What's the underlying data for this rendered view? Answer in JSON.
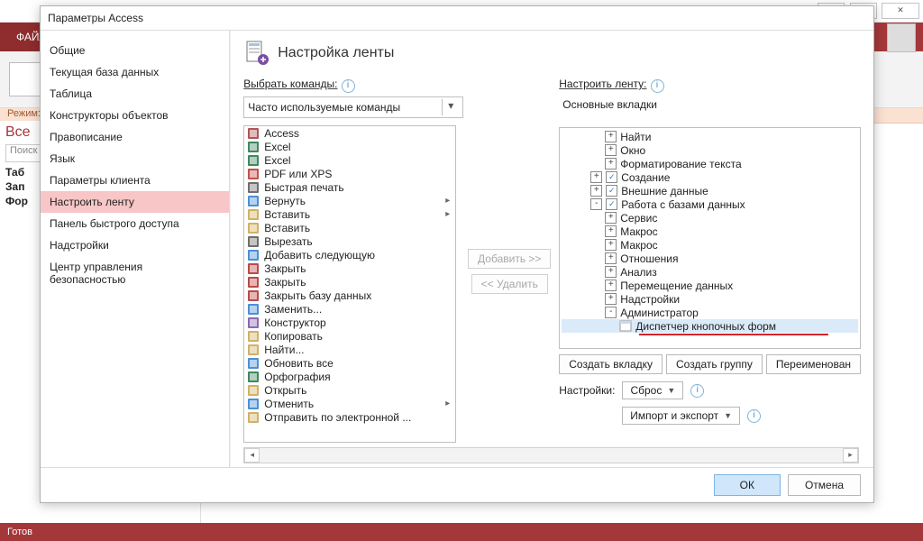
{
  "app": {
    "title_visible": "Параметры Access",
    "tab": "ФАЙЛ",
    "mode": "Режим",
    "mode2_prefix": "Режим:",
    "status": "Готов"
  },
  "bg": {
    "left_hdr": "Все",
    "search": "Поиск",
    "items": [
      "Таб",
      "Зап",
      "Фор"
    ]
  },
  "dialog": {
    "title": "Параметры Access",
    "categories": [
      "Общие",
      "Текущая база данных",
      "Таблица",
      "Конструкторы объектов",
      "Правописание",
      "Язык",
      "Параметры клиента",
      "Настроить ленту",
      "Панель быстрого доступа",
      "Надстройки",
      "Центр управления безопасностью"
    ],
    "selected_cat": 7,
    "page_title": "Настройка ленты",
    "left": {
      "label": "Выбрать команды:",
      "combo": "Часто используемые команды",
      "items": [
        {
          "t": "Access",
          "ic": "acc"
        },
        {
          "t": "Excel",
          "ic": "xls"
        },
        {
          "t": "Excel",
          "ic": "xls"
        },
        {
          "t": "PDF или XPS",
          "ic": "pdf"
        },
        {
          "t": "Быстрая печать",
          "ic": "print"
        },
        {
          "t": "Вернуть",
          "ic": "redo",
          "sub": "▸"
        },
        {
          "t": "Вставить",
          "ic": "paste",
          "sub": "▸"
        },
        {
          "t": "Вставить",
          "ic": "paste"
        },
        {
          "t": "Вырезать",
          "ic": "cut"
        },
        {
          "t": "Добавить следующую",
          "ic": "add"
        },
        {
          "t": "Закрыть",
          "ic": "close"
        },
        {
          "t": "Закрыть",
          "ic": "close"
        },
        {
          "t": "Закрыть базу данных",
          "ic": "closedb"
        },
        {
          "t": "Заменить...",
          "ic": "replace"
        },
        {
          "t": "Конструктор",
          "ic": "design"
        },
        {
          "t": "Копировать",
          "ic": "copy"
        },
        {
          "t": "Найти...",
          "ic": "find"
        },
        {
          "t": "Обновить все",
          "ic": "refresh"
        },
        {
          "t": "Орфография",
          "ic": "spell"
        },
        {
          "t": "Открыть",
          "ic": "open"
        },
        {
          "t": "Отменить",
          "ic": "undo",
          "sub": "▸"
        },
        {
          "t": "Отправить по электронной ...",
          "ic": "mail"
        }
      ]
    },
    "mid": {
      "add": "Добавить >>",
      "remove": "<< Удалить"
    },
    "right": {
      "label": "Настроить ленту:",
      "combo": "Основные вкладки",
      "nodes": [
        {
          "ind": 3,
          "exp": "+",
          "t": "Найти"
        },
        {
          "ind": 3,
          "exp": "+",
          "t": "Окно"
        },
        {
          "ind": 3,
          "exp": "+",
          "t": "Форматирование текста"
        },
        {
          "ind": 2,
          "exp": "+",
          "chk": true,
          "t": "Создание"
        },
        {
          "ind": 2,
          "exp": "+",
          "chk": true,
          "t": "Внешние данные"
        },
        {
          "ind": 2,
          "exp": "-",
          "chk": true,
          "t": "Работа с базами данных"
        },
        {
          "ind": 3,
          "exp": "+",
          "t": "Сервис"
        },
        {
          "ind": 3,
          "exp": "+",
          "t": "Макрос"
        },
        {
          "ind": 3,
          "exp": "+",
          "t": "Макрос"
        },
        {
          "ind": 3,
          "exp": "+",
          "t": "Отношения"
        },
        {
          "ind": 3,
          "exp": "+",
          "t": "Анализ"
        },
        {
          "ind": 3,
          "exp": "+",
          "t": "Перемещение данных"
        },
        {
          "ind": 3,
          "exp": "+",
          "t": "Надстройки"
        },
        {
          "ind": 3,
          "exp": "-",
          "t": "Администратор"
        },
        {
          "ind": 4,
          "leaf": true,
          "t": "Диспетчер кнопочных форм",
          "sel": true
        }
      ],
      "btn_newtab": "Создать вкладку",
      "btn_newgroup": "Создать группу",
      "btn_rename": "Переименован",
      "settings_lbl": "Настройки:",
      "reset": "Сброс",
      "import": "Импорт и экспорт"
    },
    "ok": "ОК",
    "cancel": "Отмена"
  }
}
